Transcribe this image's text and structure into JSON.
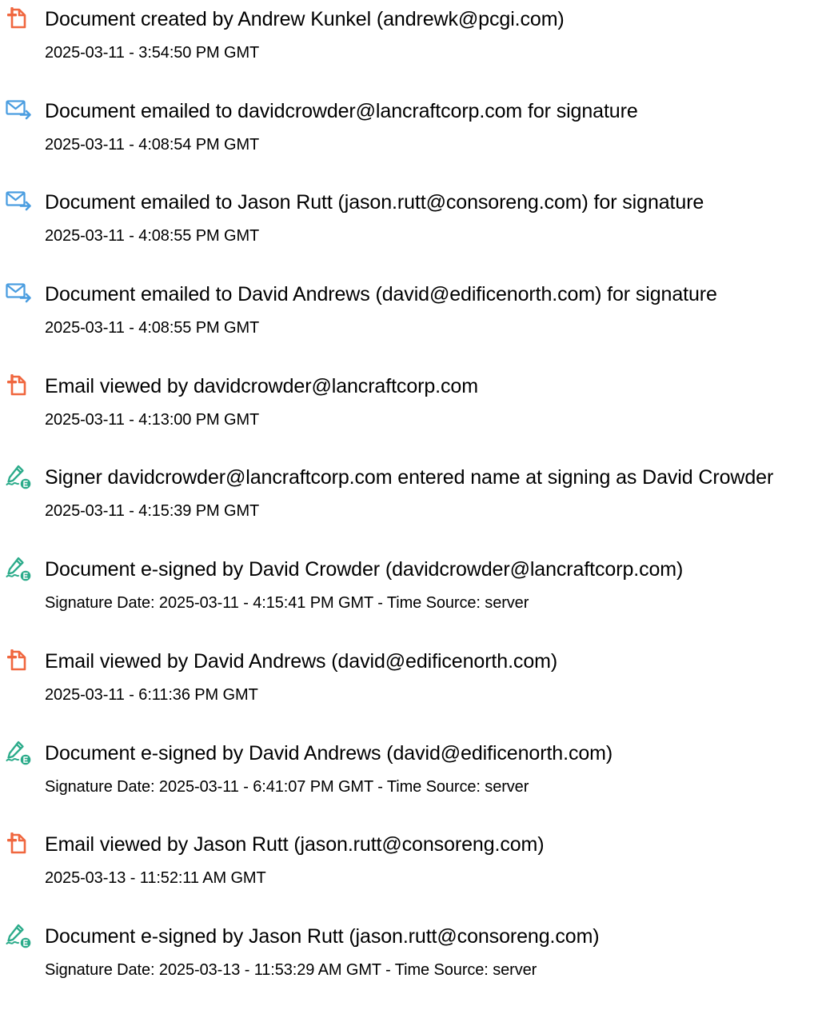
{
  "events": [
    {
      "icon": "document-created-icon",
      "title": "Document created by Andrew Kunkel (andrewk@pcgi.com)",
      "meta": "2025-03-11 - 3:54:50 PM GMT"
    },
    {
      "icon": "email-sent-icon",
      "title": "Document emailed to davidcrowder@lancraftcorp.com for signature",
      "meta": "2025-03-11 - 4:08:54 PM GMT"
    },
    {
      "icon": "email-sent-icon",
      "title": "Document emailed to Jason Rutt (jason.rutt@consoreng.com) for signature",
      "meta": "2025-03-11 - 4:08:55 PM GMT"
    },
    {
      "icon": "email-sent-icon",
      "title": "Document emailed to David Andrews (david@edificenorth.com) for signature",
      "meta": "2025-03-11 - 4:08:55 PM GMT"
    },
    {
      "icon": "document-viewed-icon",
      "title": "Email viewed by davidcrowder@lancraftcorp.com",
      "meta": "2025-03-11 - 4:13:00 PM GMT"
    },
    {
      "icon": "e-signature-icon",
      "title": "Signer davidcrowder@lancraftcorp.com entered name at signing as David Crowder",
      "meta": "2025-03-11 - 4:15:39 PM GMT"
    },
    {
      "icon": "e-signature-icon",
      "title": "Document e-signed by David Crowder (davidcrowder@lancraftcorp.com)",
      "meta": "Signature Date: 2025-03-11 - 4:15:41 PM GMT - Time Source: server"
    },
    {
      "icon": "document-viewed-icon",
      "title": "Email viewed by David Andrews (david@edificenorth.com)",
      "meta": "2025-03-11 - 6:11:36 PM GMT"
    },
    {
      "icon": "e-signature-icon",
      "title": "Document e-signed by David Andrews (david@edificenorth.com)",
      "meta": "Signature Date: 2025-03-11 - 6:41:07 PM GMT - Time Source: server"
    },
    {
      "icon": "document-viewed-icon",
      "title": "Email viewed by Jason Rutt (jason.rutt@consoreng.com)",
      "meta": "2025-03-13 - 11:52:11 AM GMT"
    },
    {
      "icon": "e-signature-icon",
      "title": "Document e-signed by Jason Rutt (jason.rutt@consoreng.com)",
      "meta": "Signature Date: 2025-03-13 - 11:53:29 AM GMT - Time Source: server"
    }
  ],
  "colors": {
    "document_icon": "#f0673f",
    "email_icon": "#4a9de0",
    "signature_icon": "#2bab8a",
    "text": "#000000"
  }
}
